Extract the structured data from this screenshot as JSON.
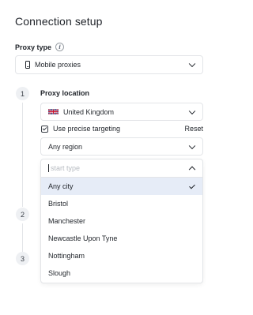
{
  "title": "Connection setup",
  "proxy_type": {
    "label": "Proxy type",
    "info_icon": "info-icon",
    "selected": "Mobile proxies",
    "icon": "phone-icon"
  },
  "steps": [
    "1",
    "2",
    "3"
  ],
  "proxy_location": {
    "label": "Proxy location",
    "country": "United Kingdom",
    "country_flag": "uk-flag-icon",
    "precise_targeting_label": "Use precise targeting",
    "precise_targeting_checked": true,
    "reset_label": "Reset",
    "region": "Any region",
    "city_dropdown": {
      "placeholder": "start type",
      "value": "",
      "selected": "Any city",
      "options": [
        "Any city",
        "Bristol",
        "Manchester",
        "Newcastle Upon Tyne",
        "Nottingham",
        "Slough"
      ]
    }
  },
  "colors": {
    "selected_option_bg": "#e6ecf7",
    "border": "#e3e5e8",
    "step_bg": "#eef0f3"
  }
}
